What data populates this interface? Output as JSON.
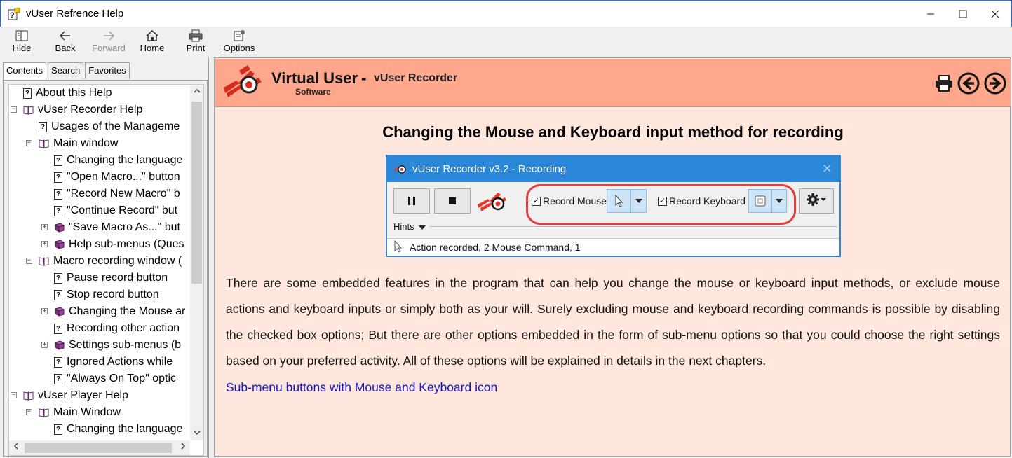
{
  "window": {
    "title": "vUser Refrence Help",
    "controls": {
      "minimize": "—",
      "maximize": "☐",
      "close": "✕"
    }
  },
  "toolbar": {
    "hide": "Hide",
    "back": "Back",
    "forward": "Forward",
    "home": "Home",
    "print": "Print",
    "options": "Options"
  },
  "tabs": [
    "Contents",
    "Search",
    "Favorites"
  ],
  "tree": [
    {
      "label": "About this Help",
      "type": "page",
      "level": 0,
      "expander": ""
    },
    {
      "label": "vUser Recorder Help",
      "type": "book-open",
      "level": 0,
      "expander": "−"
    },
    {
      "label": "Usages of the Manageme",
      "type": "page",
      "level": 1,
      "expander": ""
    },
    {
      "label": "Main window",
      "type": "book-open",
      "level": 1,
      "expander": "−"
    },
    {
      "label": "Changing the language",
      "type": "page",
      "level": 2,
      "expander": ""
    },
    {
      "label": "\"Open Macro...\" button",
      "type": "page",
      "level": 2,
      "expander": ""
    },
    {
      "label": "\"Record New Macro\" b",
      "type": "page",
      "level": 2,
      "expander": ""
    },
    {
      "label": "\"Continue Record\" but",
      "type": "page",
      "level": 2,
      "expander": ""
    },
    {
      "label": "\"Save Macro As...\" but",
      "type": "book",
      "level": 2,
      "expander": "+"
    },
    {
      "label": "Help sub-menus (Ques",
      "type": "book",
      "level": 2,
      "expander": "+"
    },
    {
      "label": "Macro recording window (",
      "type": "book-open",
      "level": 1,
      "expander": "−"
    },
    {
      "label": "Pause record button",
      "type": "page",
      "level": 2,
      "expander": ""
    },
    {
      "label": "Stop record button",
      "type": "page",
      "level": 2,
      "expander": ""
    },
    {
      "label": "Changing the Mouse ar",
      "type": "book",
      "level": 2,
      "expander": "+"
    },
    {
      "label": "Recording other action",
      "type": "page",
      "level": 2,
      "expander": ""
    },
    {
      "label": "Settings sub-menus (b",
      "type": "book",
      "level": 2,
      "expander": "+"
    },
    {
      "label": "Ignored Actions while",
      "type": "page",
      "level": 2,
      "expander": ""
    },
    {
      "label": "\"Always On Top\" optic",
      "type": "page",
      "level": 2,
      "expander": ""
    },
    {
      "label": "vUser Player Help",
      "type": "book-open",
      "level": 0,
      "expander": "−"
    },
    {
      "label": "Main Window",
      "type": "book-open",
      "level": 1,
      "expander": "−"
    },
    {
      "label": "Changing the language",
      "type": "page",
      "level": 2,
      "expander": ""
    }
  ],
  "header": {
    "brand": "Virtual User",
    "dash": "-",
    "product": "vUser Recorder",
    "sub": "Software"
  },
  "content": {
    "title": "Changing the Mouse and Keyboard input method for recording",
    "paragraph": "There are some embedded features in the program that can help you change the mouse or keyboard input methods, or exclude mouse actions and keyboard inputs or simply both as your will. Surely excluding mouse and keyboard recording commands is possible by disabling the checked box options; But there are other options embedded in the form of sub-menu options so that you could choose the right settings based on your preferred activity. All of these options will be explained in details in the next chapters.",
    "link": "Sub-menu buttons with Mouse and Keyboard icon"
  },
  "screenshot": {
    "title": "vUser Recorder v3.2 - Recording",
    "record_mouse": "Record Mouse",
    "record_keyboard": "Record Keyboard",
    "hints": "Hints",
    "status": "Action recorded, 2 Mouse Command, 1"
  },
  "colors": {
    "header_bg": "#ffa78d",
    "content_bg": "#ffe7dd",
    "link": "#1515c8",
    "accent_red": "#e53c3c",
    "screenshot_title": "#2b87d8"
  }
}
